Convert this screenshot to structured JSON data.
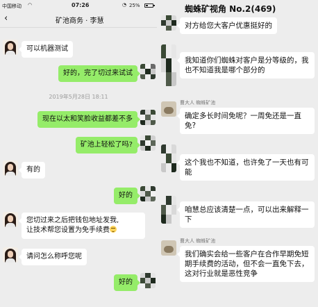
{
  "left": {
    "status_bar": {
      "carrier": "中国移动",
      "time": "07:26",
      "battery": "25%",
      "battery_level": 0.25
    },
    "header": {
      "back_glyph": "‹",
      "title": "矿池商务 · 李慧"
    },
    "messages": [
      {
        "side": "in",
        "text": "可以机器测试"
      },
      {
        "side": "out",
        "text": "好的，完了切过来试试"
      },
      {
        "side": "out",
        "text": "现在以太和笑脸收益都差不多"
      },
      {
        "side": "out",
        "text": "矿池上轻松了吗?"
      },
      {
        "side": "in",
        "text": "有的"
      },
      {
        "side": "out",
        "text": "好的"
      },
      {
        "side": "in",
        "line1": "您切过来之后把钱包地址发我,",
        "line2": "让技术帮您设置为免手续费",
        "emoji": "smile-emoji"
      },
      {
        "side": "in",
        "text": "请问怎么称呼您呢"
      },
      {
        "side": "out",
        "text": "好的"
      }
    ],
    "timestamp": "2019年5月28日 18:11"
  },
  "right": {
    "header": {
      "title": "蜘蛛矿视角 No.2(469)"
    },
    "messages": [
      {
        "text": "对方给您大客户优惠挺好的"
      },
      {
        "text": "我知道你们蜘蛛对客户是分等级的，我也不知道我是哪个部分的"
      },
      {
        "sender": "曹大人 蜘蛛矿池",
        "text": "确定多长时间免呢？一周免还是一直免?"
      },
      {
        "text": "这个我也不知道，也许免了一天也有可能"
      },
      {
        "text": "咱慧总应该清楚一点，可以出来解释一下"
      },
      {
        "sender": "曹大人 蜘蛛矿池",
        "text": "我们确实会给一些客户在合作早期免短期手续费的活动，但不会一直免下去，这对行业就是恶性竞争"
      }
    ]
  },
  "colors": {
    "outgoing_bubble": "#95ec69",
    "incoming_bubble": "#ffffff",
    "chat_background": "#ededed"
  },
  "icons": [
    "back-arrow-icon",
    "wifi-icon",
    "alarm-icon",
    "battery-icon",
    "smile-emoji-icon"
  ]
}
